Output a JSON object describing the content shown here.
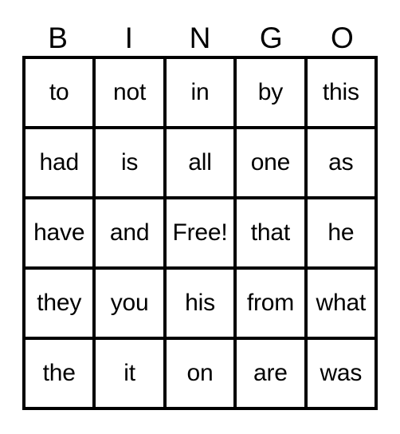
{
  "card": {
    "title": "BINGO",
    "columns": [
      "B",
      "I",
      "N",
      "G",
      "O"
    ],
    "free_space_label": "Free!",
    "colors": {
      "border": "#000000",
      "cell_background": "#ffffff",
      "text": "#000000",
      "page_background": "#ffffff"
    },
    "rows": [
      {
        "cells": [
          "to",
          "not",
          "in",
          "by",
          "this"
        ]
      },
      {
        "cells": [
          "had",
          "is",
          "all",
          "one",
          "as"
        ]
      },
      {
        "cells": [
          "have",
          "and",
          "Free!",
          "that",
          "he"
        ]
      },
      {
        "cells": [
          "they",
          "you",
          "his",
          "from",
          "what"
        ]
      },
      {
        "cells": [
          "the",
          "it",
          "on",
          "are",
          "was"
        ]
      }
    ]
  }
}
